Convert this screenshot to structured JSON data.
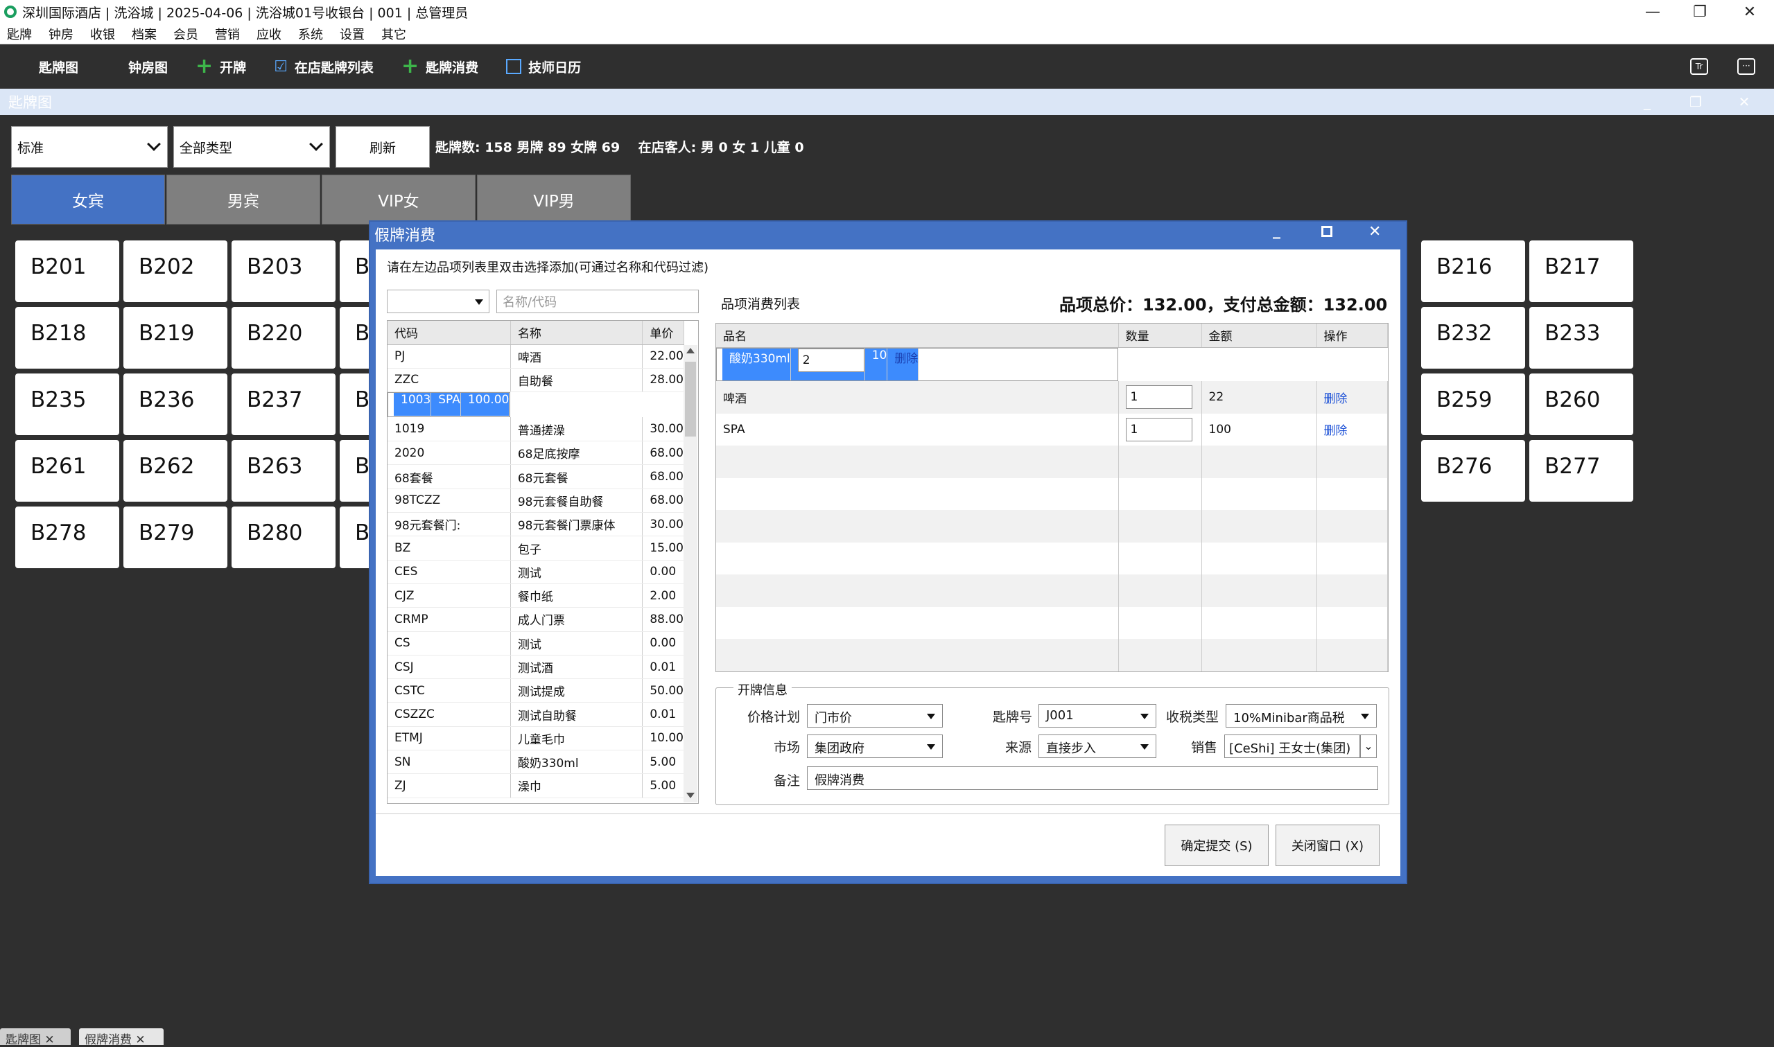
{
  "window": {
    "title": "深圳国际酒店 | 洗浴城 | 2025-04-06 | 洗浴城01号收银台 | 001 | 总管理员"
  },
  "menu": [
    "匙牌",
    "钟房",
    "收银",
    "档案",
    "会员",
    "营销",
    "应收",
    "系统",
    "设置",
    "其它"
  ],
  "toolbar": [
    {
      "label": "匙牌图",
      "icon": "grid-icon"
    },
    {
      "label": "钟房图",
      "icon": "grid-icon"
    },
    {
      "label": "开牌",
      "icon": "plus-icon"
    },
    {
      "label": "在店匙牌列表",
      "icon": "check-list-icon"
    },
    {
      "label": "匙牌消费",
      "icon": "plus-icon"
    },
    {
      "label": "技师日历",
      "icon": "calendar-icon"
    }
  ],
  "subwindow": {
    "title": "匙牌图"
  },
  "filters": {
    "mode": "标准",
    "type": "全部类型",
    "refresh": "刷新",
    "stats": "匙牌数: 158 男牌 89 女牌 69    在店客人: 男 0 女 1 儿童 0"
  },
  "tabs": [
    "女宾",
    "男宾",
    "VIP女",
    "VIP男"
  ],
  "rooms": {
    "r1": [
      "B201",
      "B202",
      "B203",
      "B216",
      "B217"
    ],
    "r2": [
      "B218",
      "B219",
      "B220",
      "B232",
      "B233"
    ],
    "r3": [
      "B235",
      "B236",
      "B237",
      "B259",
      "B260"
    ],
    "r4": [
      "B261",
      "B262",
      "B263",
      "B276",
      "B277"
    ],
    "r5": [
      "B278",
      "B279",
      "B280"
    ]
  },
  "room_partial": "B",
  "bottom_tabs": [
    "匙牌图",
    "假牌消费"
  ],
  "dialog": {
    "title": "假牌消费",
    "hint": "请在左边品项列表里双击选择添加(可通过名称和代码过滤)",
    "filter_placeholder": "名称/代码",
    "left_headers": [
      "代码",
      "名称",
      "单价"
    ],
    "items": [
      [
        "PJ",
        "啤酒",
        "22.00"
      ],
      [
        "ZZC",
        "自助餐",
        "28.00"
      ],
      [
        "1003",
        "SPA",
        "100.00"
      ],
      [
        "1019",
        "普通搓澡",
        "30.00"
      ],
      [
        "2020",
        "68足底按摩",
        "68.00"
      ],
      [
        "68套餐",
        "68元套餐",
        "68.00"
      ],
      [
        "98TCZZ",
        "98元套餐自助餐",
        "68.00"
      ],
      [
        "98元套餐门:",
        "98元套餐门票康体",
        "30.00"
      ],
      [
        "BZ",
        "包子",
        "15.00"
      ],
      [
        "CES",
        "测试",
        "0.00"
      ],
      [
        "CJZ",
        "餐巾纸",
        "2.00"
      ],
      [
        "CRMP",
        "成人门票",
        "88.00"
      ],
      [
        "CS",
        "测试",
        "0.00"
      ],
      [
        "CSJ",
        "测试酒",
        "0.01"
      ],
      [
        "CSTC",
        "测试提成",
        "50.00"
      ],
      [
        "CSZZC",
        "测试自助餐",
        "0.01"
      ],
      [
        "ETMJ",
        "儿童毛巾",
        "10.00"
      ],
      [
        "SN",
        "酸奶330ml",
        "5.00"
      ],
      [
        "ZJ",
        "澡巾",
        "5.00"
      ]
    ],
    "right_title": "品项消费列表",
    "totals": "品项总价：132.00，支付总金额：132.00",
    "right_headers": [
      "品名",
      "数量",
      "金额",
      "操作"
    ],
    "lines": [
      [
        "酸奶330ml",
        "2",
        "10",
        "删除"
      ],
      [
        "啤酒",
        "1",
        "22",
        "删除"
      ],
      [
        "SPA",
        "1",
        "100",
        "删除"
      ]
    ],
    "info": {
      "legend": "开牌信息",
      "price_plan_label": "价格计划",
      "price_plan": "门市价",
      "card_label": "匙牌号",
      "card": "J001",
      "tax_label": "收税类型",
      "tax": "10%Minibar商品税",
      "market_label": "市场",
      "market": "集团政府",
      "source_label": "来源",
      "source": "直接步入",
      "sales_label": "销售",
      "sales": "[CeShi] 王女士(集团)",
      "note_label": "备注",
      "note": "假牌消费"
    },
    "submit": "确定提交 (S)",
    "close": "关闭窗口 (X)"
  }
}
